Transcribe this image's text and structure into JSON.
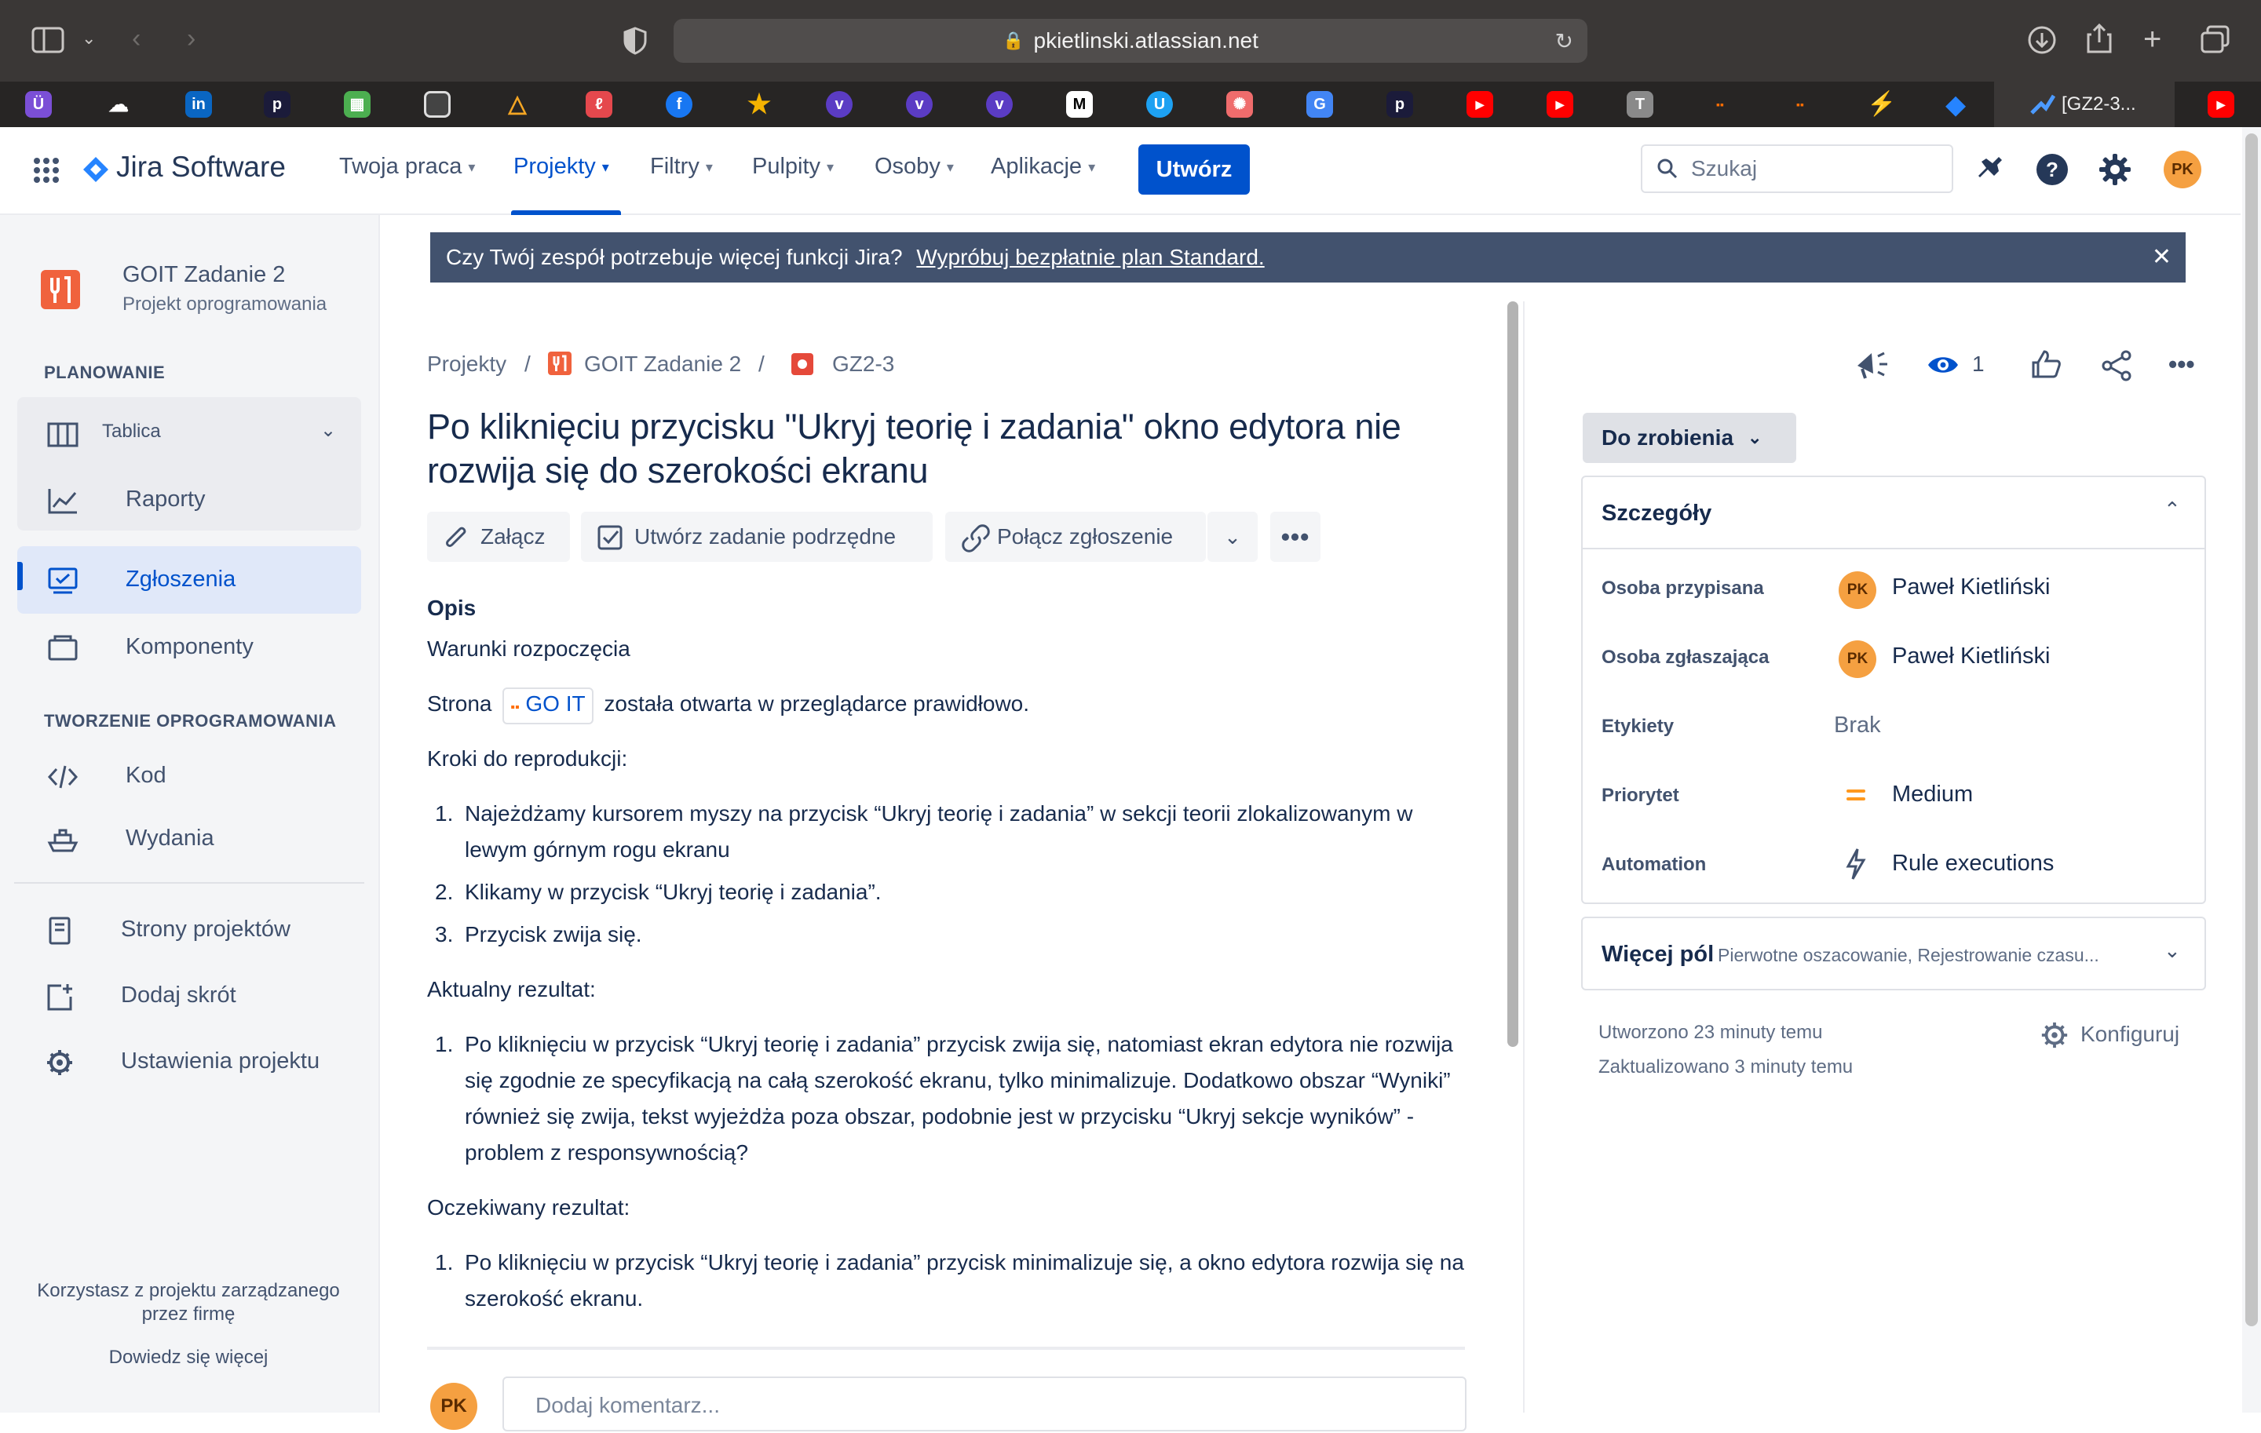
{
  "browser": {
    "url": "pkietlinski.atlassian.net",
    "active_tab_title": "[GZ2-3..."
  },
  "nav": {
    "logo_text": "Jira Software",
    "items": [
      "Twoja praca",
      "Projekty",
      "Filtry",
      "Pulpity",
      "Osoby",
      "Aplikacje"
    ],
    "create_label": "Utwórz",
    "search_placeholder": "Szukaj",
    "avatar_initials": "PK"
  },
  "sidebar": {
    "project_name": "GOIT Zadanie 2",
    "project_type": "Projekt oprogramowania",
    "section_planning": "PLANOWANIE",
    "board_label": "Tablica",
    "reports_label": "Raporty",
    "issues_label": "Zgłoszenia",
    "components_label": "Komponenty",
    "section_dev": "TWORZENIE OPROGRAMOWANIA",
    "code_label": "Kod",
    "releases_label": "Wydania",
    "pages_label": "Strony projektów",
    "shortcut_label": "Dodaj skrót",
    "settings_label": "Ustawienia projektu",
    "managed_note": "Korzystasz z projektu zarządzanego przez firmę",
    "learn_more": "Dowiedz się więcej"
  },
  "banner": {
    "text": "Czy Twój zespół potrzebuje więcej funkcji Jira?",
    "link": "Wypróbuj bezpłatnie plan Standard."
  },
  "breadcrumb": {
    "projects": "Projekty",
    "separator": "/",
    "project": "GOIT Zadanie 2",
    "issue_key": "GZ2-3"
  },
  "issue": {
    "title": "Po kliknięciu przycisku \"Ukryj teorię i zadania\" okno edytora nie rozwija się do szerokości ekranu",
    "actions": {
      "attach": "Załącz",
      "create_subtask": "Utwórz zadanie podrzędne",
      "link_issue": "Połącz zgłoszenie"
    },
    "description": {
      "heading": "Opis",
      "preconditions": "Warunki rozpoczęcia",
      "page_prefix": "Strona",
      "page_chip": "GO IT",
      "page_suffix": "została otwarta w przeglądarce prawidłowo.",
      "steps_heading": "Kroki do reprodukcji:",
      "steps": [
        "Najeżdżamy kursorem myszy na przycisk “Ukryj teorię i zadania” w sekcji teorii zlokalizowanym w lewym górnym rogu ekranu",
        "Klikamy w przycisk “Ukryj teorię i zadania”.",
        "Przycisk zwija się."
      ],
      "actual_heading": "Aktualny rezultat:",
      "actual": [
        "Po kliknięciu w przycisk “Ukryj teorię i zadania” przycisk zwija się, natomiast ekran edytora nie rozwija się zgodnie ze specyfikacją na całą szerokość ekranu, tylko minimalizuje. Dodatkowo obszar “Wyniki” również się zwija, tekst  wyjeżdża poza obszar, podobnie jest w przycisku “Ukryj sekcje wyników” - problem z responsywnością?"
      ],
      "expected_heading": "Oczekiwany rezultat:",
      "expected": [
        "Po kliknięciu w przycisk “Ukryj teorię i zadania” przycisk minimalizuje się, a okno edytora rozwija się na szerokość ekranu."
      ]
    },
    "comment_placeholder": "Dodaj komentarz..."
  },
  "panel": {
    "watchers_count": "1",
    "status": "Do zrobienia",
    "details_heading": "Szczegóły",
    "fields": {
      "assignee_label": "Osoba przypisana",
      "assignee": "Paweł Kietliński",
      "reporter_label": "Osoba zgłaszająca",
      "reporter": "Paweł Kietliński",
      "labels_label": "Etykiety",
      "labels": "Brak",
      "priority_label": "Priorytet",
      "priority": "Medium",
      "automation_label": "Automation",
      "automation": "Rule executions"
    },
    "more_fields_heading": "Więcej pól",
    "more_fields_desc": "Pierwotne oszacowanie, Rejestrowanie czasu...",
    "created": "Utworzono 23 minuty temu",
    "updated": "Zaktualizowano 3 minuty temu",
    "configure": "Konfiguruj"
  },
  "colors": {
    "brand_blue": "#0052cc",
    "banner_bg": "#42526e",
    "avatar_orange": "#f5a041",
    "priority_medium": "#ff991f"
  }
}
